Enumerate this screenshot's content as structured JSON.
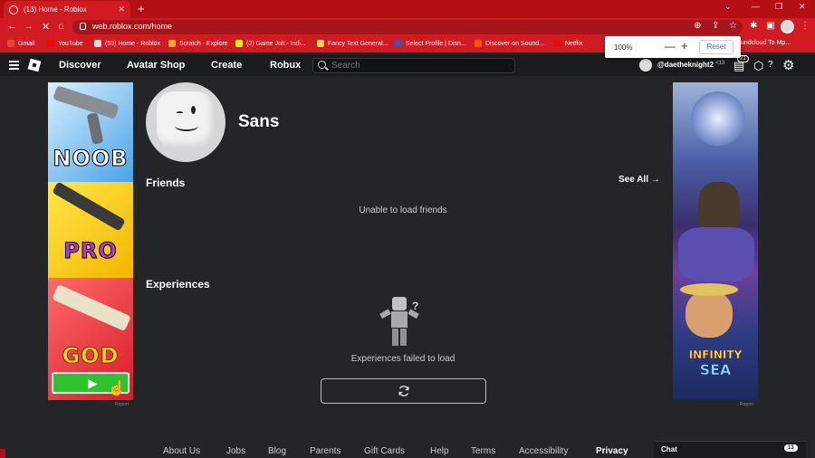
{
  "browser": {
    "tab_title": "(13) Home - Roblox",
    "new_tab": "+",
    "url": "web.roblox.com/home",
    "window_controls": {
      "minimize": "—",
      "restore": "❐",
      "close": "✕"
    },
    "bookmarks": [
      {
        "label": "Gmail",
        "color": "#ea4335"
      },
      {
        "label": "YouTube",
        "color": "#ff0000"
      },
      {
        "label": "(59) Home - Roblox",
        "color": "#dddddd"
      },
      {
        "label": "Scratch - Explore",
        "color": "#f9a825"
      },
      {
        "label": "(3) Game Jolt - Indi...",
        "color": "#ccff00"
      },
      {
        "label": "Fancy Text Generat...",
        "color": "#ffd54f"
      },
      {
        "label": "Select Profile | Disn...",
        "color": "#3f51b5"
      },
      {
        "label": "Discover on Sound...",
        "color": "#ff5500"
      },
      {
        "label": "Netflix",
        "color": "#e50914"
      },
      {
        "label": "undcloud To Mp...",
        "color": "#ff7700"
      }
    ],
    "zoom": {
      "percent": "100%",
      "minus": "—",
      "plus": "+",
      "reset": "Reset"
    }
  },
  "roblox_nav": {
    "items": [
      "Discover",
      "Avatar Shop",
      "Create",
      "Robux"
    ],
    "search_placeholder": "Search",
    "username": "@daetheknight2",
    "age": "<13",
    "notifications": "21"
  },
  "ads": {
    "left_words": [
      "NOOB",
      "PRO",
      "GOD"
    ],
    "right_words": [
      "INFINITY",
      "SEA"
    ],
    "report": "Report"
  },
  "profile": {
    "display_name": "Sans"
  },
  "friends": {
    "heading": "Friends",
    "see_all": "See All →",
    "error": "Unable to load friends"
  },
  "experiences": {
    "heading": "Experiences",
    "error": "Experiences failed to load"
  },
  "footer": {
    "links": [
      "About Us",
      "Jobs",
      "Blog",
      "Parents",
      "Gift Cards",
      "Help",
      "Terms",
      "Accessibility",
      "Privacy"
    ]
  },
  "chat": {
    "label": "Chat",
    "count": "13"
  }
}
